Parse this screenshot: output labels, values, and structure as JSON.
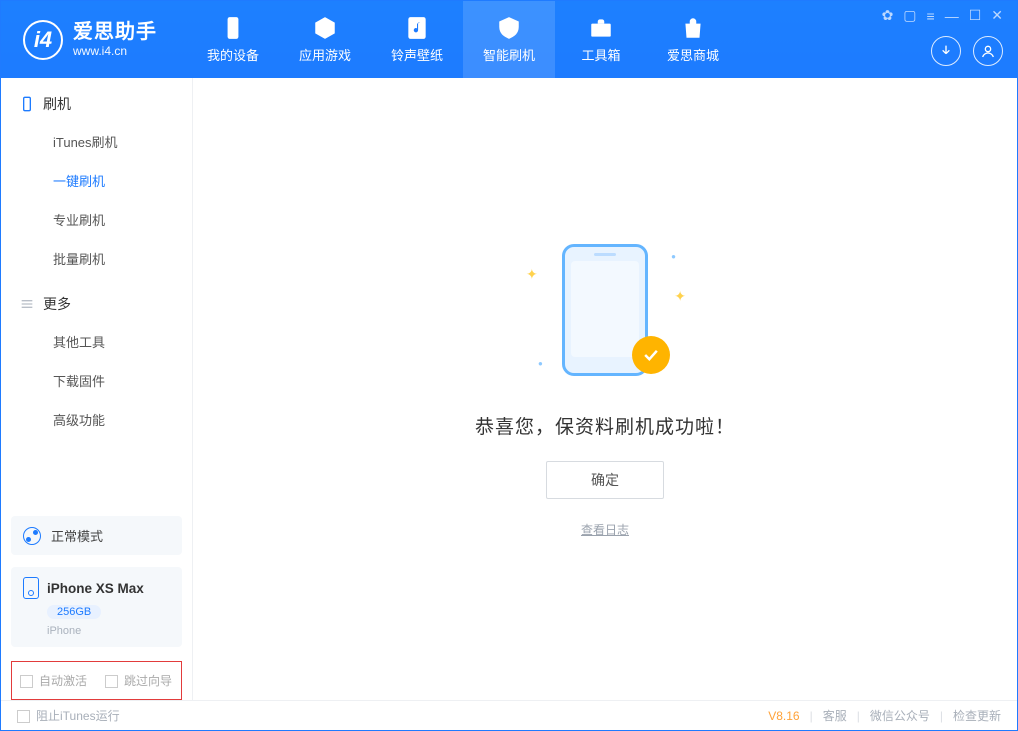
{
  "app": {
    "title": "爱思助手",
    "subtitle": "www.i4.cn"
  },
  "nav": {
    "tabs": [
      {
        "id": "device",
        "label": "我的设备"
      },
      {
        "id": "apps",
        "label": "应用游戏"
      },
      {
        "id": "ring",
        "label": "铃声壁纸"
      },
      {
        "id": "flash",
        "label": "智能刷机",
        "active": true
      },
      {
        "id": "tools",
        "label": "工具箱"
      },
      {
        "id": "store",
        "label": "爱思商城"
      }
    ]
  },
  "sidebar": {
    "groups": [
      {
        "id": "flash",
        "title": "刷机",
        "items": [
          {
            "id": "itunes",
            "label": "iTunes刷机"
          },
          {
            "id": "onekey",
            "label": "一键刷机",
            "active": true
          },
          {
            "id": "pro",
            "label": "专业刷机"
          },
          {
            "id": "batch",
            "label": "批量刷机"
          }
        ]
      },
      {
        "id": "more",
        "title": "更多",
        "items": [
          {
            "id": "other",
            "label": "其他工具"
          },
          {
            "id": "dlfw",
            "label": "下载固件"
          },
          {
            "id": "adv",
            "label": "高级功能"
          }
        ]
      }
    ],
    "mode": {
      "label": "正常模式"
    },
    "device": {
      "name": "iPhone XS Max",
      "capacity": "256GB",
      "type": "iPhone"
    },
    "options": {
      "auto_activate": "自动激活",
      "skip_guide": "跳过向导"
    }
  },
  "main": {
    "success_text": "恭喜您，保资料刷机成功啦！",
    "ok_button": "确定",
    "log_link": "查看日志"
  },
  "footer": {
    "block_itunes": "阻止iTunes运行",
    "version": "V8.16",
    "links": {
      "service": "客服",
      "wechat": "微信公众号",
      "update": "检查更新"
    }
  }
}
